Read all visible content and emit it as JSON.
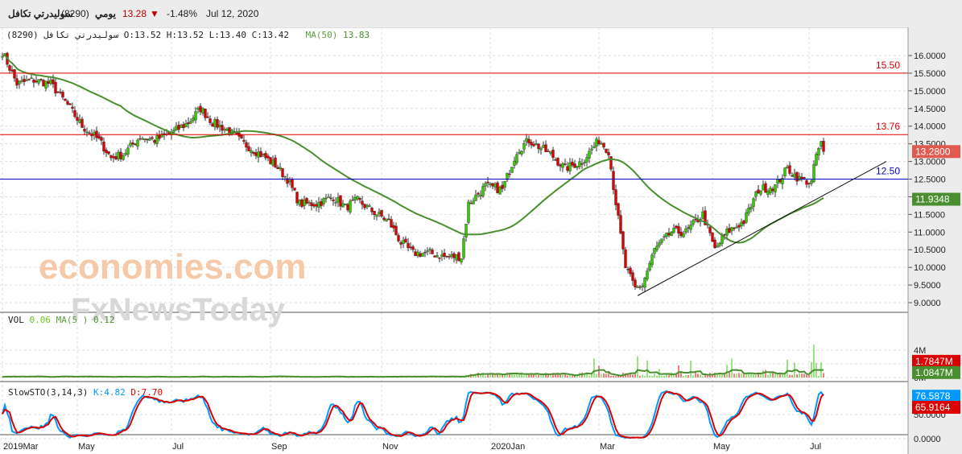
{
  "header": {
    "symbol": "سوليدرتي تكافل",
    "code": "(8290)",
    "period": "يومي",
    "price": "13.28",
    "change": "-1.48%",
    "date": "Jul 12, 2020",
    "down_color": "#c00000"
  },
  "legend": {
    "symbol": "سوليدرتي تكافل (8290)",
    "ohlc": "O:13.52 H:13.52 L:13.40 C:13.42",
    "ma_label": "MA(50)",
    "ma_value": "13.83"
  },
  "vol_legend": {
    "label": "VOL",
    "value": "0.06",
    "ma_label": "MA(5 )",
    "ma_value": "0.12"
  },
  "sto_legend": {
    "label": "SlowSTO(3,14,3)",
    "k": "K:4.82",
    "d": "D:7.70"
  },
  "watermark": {
    "a": "economies.com",
    "b": "FxNewsToday"
  },
  "chart_data": {
    "type": "candlestick",
    "title": "سوليدرتي تكافل (8290)",
    "price_axis": {
      "ticks": [
        "16.0000",
        "15.5000",
        "15.0000",
        "14.5000",
        "14.0000",
        "13.5000",
        "13.0000",
        "12.5000",
        "12.0000",
        "11.5000",
        "11.0000",
        "10.5000",
        "10.0000",
        "9.5000",
        "9.0000"
      ],
      "range": [
        8.75,
        16.75
      ]
    },
    "vol_axis": {
      "ticks": [
        "4M",
        "2M",
        "0M"
      ],
      "range": [
        0,
        5.2
      ]
    },
    "sto_axis": {
      "ticks": [
        "50.0000",
        "0.0000"
      ],
      "range": [
        -5,
        110
      ]
    },
    "x_ticks": [
      {
        "day": 0,
        "label": "2019Mar"
      },
      {
        "day": 31,
        "label": "May"
      },
      {
        "day": 70,
        "label": "Jul"
      },
      {
        "day": 111,
        "label": "Sep"
      },
      {
        "day": 157,
        "label": "Nov"
      },
      {
        "day": 202,
        "label": "2020Jan"
      },
      {
        "day": 247,
        "label": "Mar"
      },
      {
        "day": 294,
        "label": "May"
      },
      {
        "day": 334,
        "label": "Jul"
      }
    ],
    "close_waypoints": [
      [
        0,
        16.1
      ],
      [
        6,
        15.2
      ],
      [
        13,
        15.3
      ],
      [
        20,
        15.2
      ],
      [
        27,
        14.6
      ],
      [
        33,
        14.0
      ],
      [
        40,
        13.6
      ],
      [
        45,
        13.1
      ],
      [
        50,
        13.2
      ],
      [
        57,
        13.7
      ],
      [
        63,
        13.6
      ],
      [
        70,
        13.8
      ],
      [
        77,
        14.1
      ],
      [
        82,
        14.5
      ],
      [
        87,
        14.1
      ],
      [
        93,
        13.9
      ],
      [
        100,
        13.5
      ],
      [
        107,
        13.2
      ],
      [
        113,
        12.9
      ],
      [
        118,
        12.5
      ],
      [
        123,
        11.8
      ],
      [
        130,
        11.8
      ],
      [
        137,
        12.0
      ],
      [
        142,
        11.7
      ],
      [
        147,
        11.9
      ],
      [
        153,
        11.6
      ],
      [
        160,
        11.3
      ],
      [
        165,
        10.7
      ],
      [
        170,
        10.4
      ],
      [
        177,
        10.4
      ],
      [
        183,
        10.3
      ],
      [
        190,
        10.3
      ],
      [
        193,
        11.8
      ],
      [
        200,
        12.3
      ],
      [
        207,
        12.2
      ],
      [
        213,
        13.3
      ],
      [
        218,
        13.6
      ],
      [
        227,
        13.2
      ],
      [
        233,
        12.8
      ],
      [
        240,
        13.0
      ],
      [
        247,
        13.6
      ],
      [
        251,
        13.3
      ],
      [
        253,
        12.3
      ],
      [
        256,
        10.9
      ],
      [
        258,
        10.0
      ],
      [
        262,
        9.4
      ],
      [
        265,
        9.5
      ],
      [
        270,
        10.5
      ],
      [
        277,
        11.0
      ],
      [
        283,
        11.0
      ],
      [
        290,
        11.5
      ],
      [
        295,
        10.5
      ],
      [
        300,
        11.0
      ],
      [
        307,
        11.3
      ],
      [
        313,
        12.2
      ],
      [
        320,
        12.3
      ],
      [
        325,
        12.8
      ],
      [
        330,
        12.5
      ],
      [
        335,
        12.4
      ],
      [
        337,
        13.2
      ],
      [
        339,
        13.5
      ],
      [
        340,
        13.28
      ]
    ],
    "hlines": [
      {
        "value": 15.5,
        "label": "15.50",
        "color": "#e00000"
      },
      {
        "value": 13.76,
        "label": "13.76",
        "color": "#e00000"
      },
      {
        "value": 12.5,
        "label": "12.50",
        "color": "#0000c0"
      }
    ],
    "trendline": [
      [
        263,
        9.2
      ],
      [
        366,
        13.0
      ]
    ],
    "ma50_last": "11.9348",
    "price_last": "13.2800",
    "vol_last": "1.7847M",
    "vol_ma_last": "1.0847M",
    "sto_k_last": "76.5878",
    "sto_d_last": "65.9164",
    "colors": {
      "up": "#33cc00",
      "down": "#e00000",
      "ma": "#4a8f2f",
      "k": "#0099ff",
      "d": "#dd0000"
    }
  }
}
